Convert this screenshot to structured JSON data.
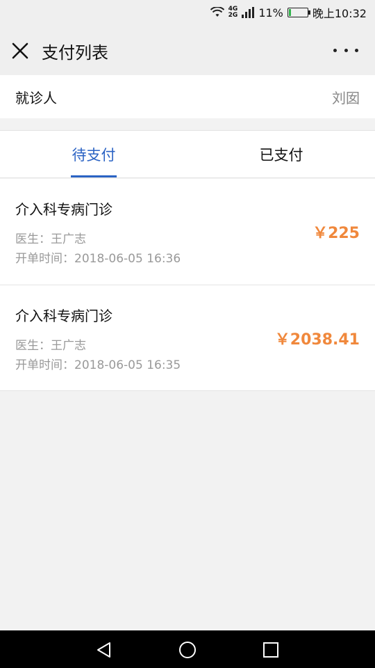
{
  "status_bar": {
    "network": [
      "4G",
      "2G"
    ],
    "battery_percent": "11%",
    "battery_level": 0.11,
    "time": "晚上10:32"
  },
  "nav": {
    "title": "支付列表"
  },
  "patient": {
    "label": "就诊人",
    "name": "刘囡"
  },
  "tabs": [
    {
      "label": "待支付",
      "active": true
    },
    {
      "label": "已支付",
      "active": false
    }
  ],
  "items": [
    {
      "title": "介入科专病门诊",
      "doctor": "医生：王广志",
      "time": "开单时间：2018-06-05 16:36",
      "amount": "￥225"
    },
    {
      "title": "介入科专病门诊",
      "doctor": "医生：王广志",
      "time": "开单时间：2018-06-05 16:35",
      "amount": "￥2038.41"
    }
  ],
  "colors": {
    "accent": "#2b63c4",
    "amount": "#f0883c",
    "battery": "#2fb34a"
  }
}
